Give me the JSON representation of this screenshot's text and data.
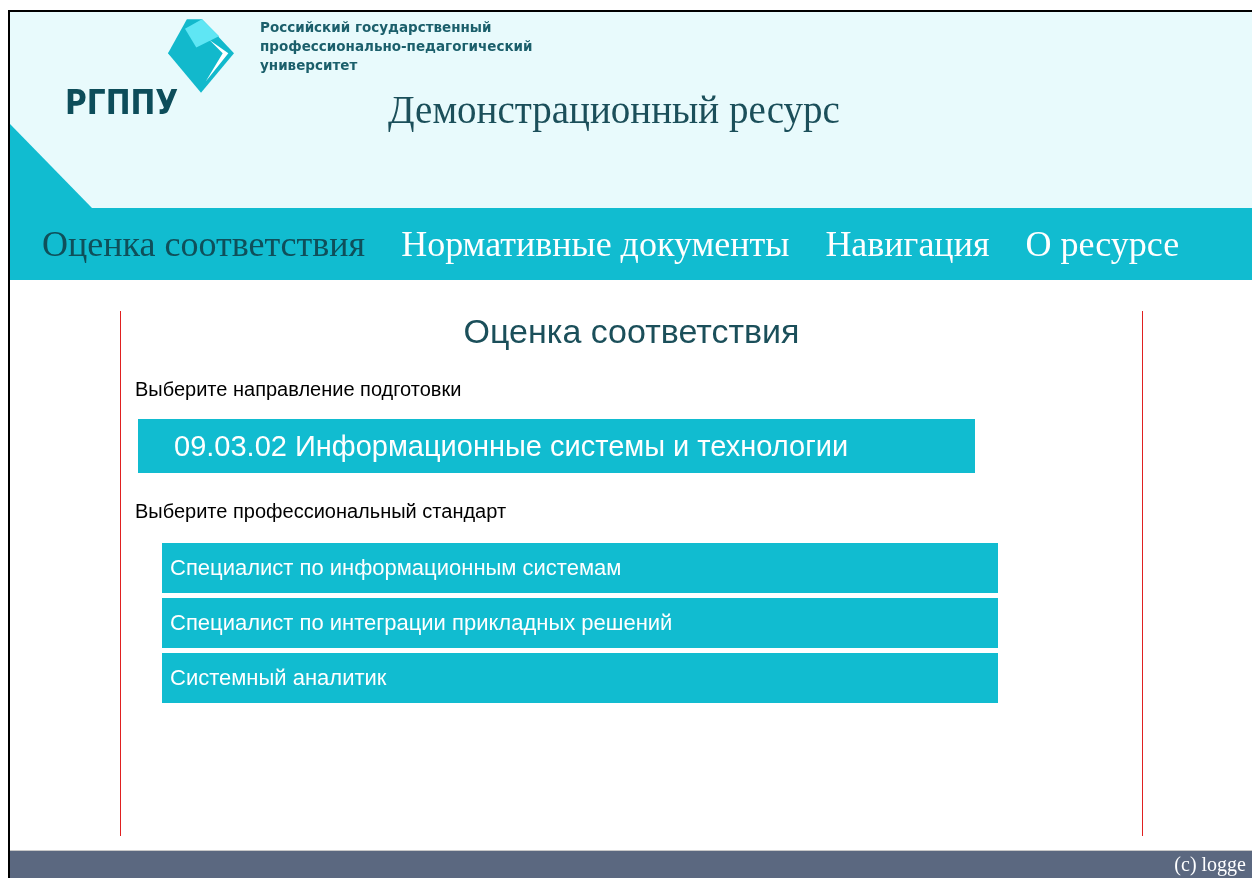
{
  "header": {
    "abbreviation": "РГППУ",
    "university_name_lines": [
      "Российский государственный",
      "профессионально-педагогический",
      "университет"
    ],
    "title": "Демонстрационный ресурс"
  },
  "nav": [
    {
      "label": "Оценка соответствия",
      "selected": true
    },
    {
      "label": "Нормативные документы",
      "selected": false
    },
    {
      "label": "Навигация",
      "selected": false
    },
    {
      "label": "О ресурсе",
      "selected": false
    }
  ],
  "main": {
    "heading": "Оценка соответствия",
    "direction_label": "Выберите направление подготовки",
    "direction": "09.03.02 Информационные системы и технологии",
    "standard_label": "Выберите профессиональный стандарт",
    "standards": [
      "Специалист по информационным системам",
      "Специалист по интеграции прикладных решений",
      "Системный аналитик"
    ]
  },
  "footer": {
    "text": "(c) logge"
  }
}
